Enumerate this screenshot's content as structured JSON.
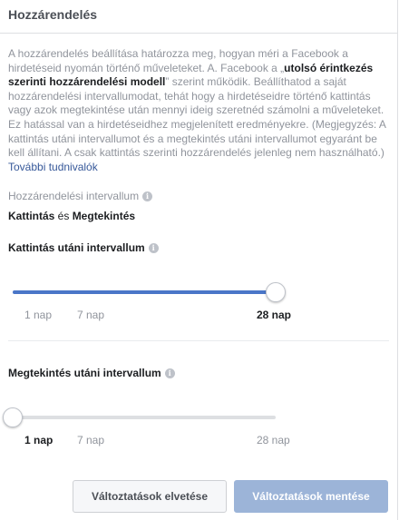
{
  "header": {
    "title": "Hozzárendelés"
  },
  "description": {
    "text_1": "A hozzárendelés beállítása határozza meg, hogyan méri a Facebook a hirdetéseid nyomán történő műveleteket. A. Facebook a „",
    "bold_1": "utolsó érintkezés szerinti hozzárendelési modell",
    "text_2": "” szerint működik. Beállíthatod a saját hozzárendelési intervallumodat, tehát hogy a hirdetéseidre történő kattintás vagy azok megtekintése után mennyi ideig szeretnéd számolni a műveleteket. Ez hatással van a hirdetéseidhez megjelenített eredményekre. (Megjegyzés: A kattintás utáni intervallumot és a megtekintés utáni intervallumot egyaránt be kell állítani. A csak kattintás szerinti hozzárendelés jelenleg nem használható.)",
    "link": "További tudnivalók"
  },
  "attribution_window": {
    "label": "Hozzárendelési intervallum",
    "value_bold_1": "Kattintás",
    "value_connector": " és ",
    "value_bold_2": "Megtekintés"
  },
  "click_window": {
    "label": "Kattintás utáni intervallum",
    "options": [
      "1 nap",
      "7 nap",
      "28 nap"
    ],
    "selected": "28 nap",
    "selected_fraction": 1.0
  },
  "view_window": {
    "label": "Megtekintés utáni intervallum",
    "options": [
      "1 nap",
      "7 nap",
      "28 nap"
    ],
    "selected": "1 nap",
    "selected_fraction": 0.0
  },
  "buttons": {
    "discard": "Változtatások elvetése",
    "save": "Változtatások mentése"
  },
  "colors": {
    "accent": "#4a76c8",
    "link": "#365899",
    "save_disabled": "#9cb4d8"
  },
  "icons": {
    "info": "info-icon"
  }
}
